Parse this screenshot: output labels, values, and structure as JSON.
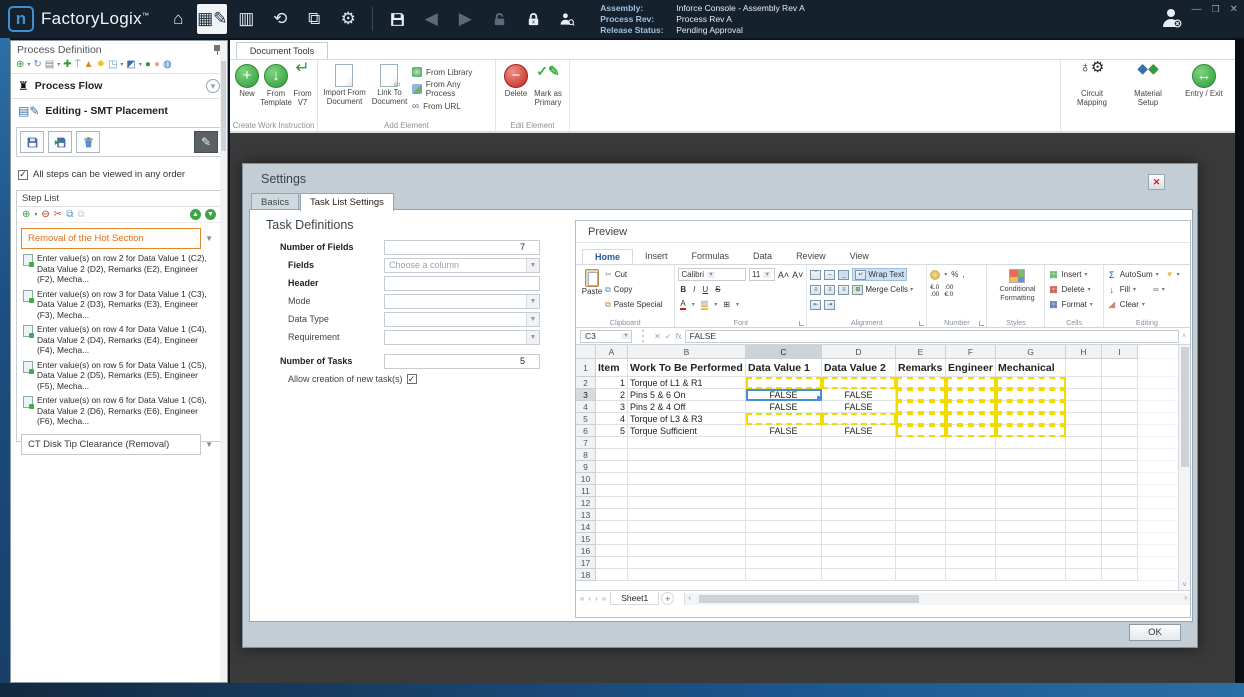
{
  "titlebar": {
    "logo_text": "FactoryLogix",
    "assembly_label": "Assembly:",
    "assembly_value": "Inforce Console - Assembly Rev A",
    "process_rev_label": "Process Rev:",
    "process_rev_value": "Process Rev A",
    "release_label": "Release Status:",
    "release_value": "Pending Approval"
  },
  "left_panel": {
    "title": "Process Definition",
    "process_flow_label": "Process Flow",
    "editing_label": "Editing - SMT Placement",
    "any_order_checkbox": "All steps can be viewed in any order",
    "step_list_title": "Step List",
    "group1": "Removal of the Hot Section",
    "steps": [
      {
        "text": "Enter value(s) on row 2 for Data Value 1 (C2), Data Value 2 (D2), Remarks (E2), Engineer (F2), Mecha..."
      },
      {
        "text": "Enter value(s) on row 3 for Data Value 1 (C3), Data Value 2 (D3), Remarks (E3), Engineer (F3), Mecha..."
      },
      {
        "text": "Enter value(s) on row 4 for Data Value 1 (C4), Data Value 2 (D4), Remarks (E4), Engineer (F4), Mecha..."
      },
      {
        "text": "Enter value(s) on row 5 for Data Value 1 (C5), Data Value 2 (D5), Remarks (E5), Engineer (F5), Mecha..."
      },
      {
        "text": "Enter value(s) on row 6 for Data Value 1 (C6), Data Value 2 (D6), Remarks (E6), Engineer (F6), Mecha..."
      }
    ],
    "group2": "CT Disk Tip Clearance (Removal)"
  },
  "ribbon": {
    "tab": "Document Tools",
    "group1_label": "Create Work Instruction",
    "new_label": "New",
    "from_template_label": "From Template",
    "from_v7_label": "From V7",
    "group2_label": "Add Element",
    "import_from_document_label": "Import From Document",
    "link_to_document_label": "Link To Document",
    "from_library_label": "From Library",
    "from_any_process_label": "From Any Process",
    "from_url_label": "From URL",
    "group3_label": "Edit Element",
    "delete_label": "Delete",
    "mark_as_primary_label": "Mark as Primary",
    "circuit_mapping_label": "Circuit Mapping",
    "material_setup_label": "Material Setup",
    "entry_exit_label": "Entry / Exit"
  },
  "dialog": {
    "title": "Settings",
    "tab_basics": "Basics",
    "tab_task_list": "Task List Settings",
    "section_title": "Task Definitions",
    "fields": {
      "number_of_fields_label": "Number of Fields",
      "number_of_fields_value": "7",
      "fields_label": "Fields",
      "fields_placeholder": "Choose a column",
      "header_label": "Header",
      "mode_label": "Mode",
      "data_type_label": "Data Type",
      "requirement_label": "Requirement",
      "number_of_tasks_label": "Number of Tasks",
      "number_of_tasks_value": "5",
      "allow_new_tasks_label": "Allow creation of new task(s)"
    },
    "ok_label": "OK"
  },
  "preview": {
    "title": "Preview",
    "excel": {
      "tabs": [
        "Home",
        "Insert",
        "Formulas",
        "Data",
        "Review",
        "View"
      ],
      "clipboard": {
        "paste": "Paste",
        "cut": "Cut",
        "copy": "Copy",
        "paste_special": "Paste Special",
        "label": "Clipboard"
      },
      "font": {
        "name": "Calibri",
        "size": "11",
        "label": "Font"
      },
      "alignment": {
        "wrap": "Wrap Text",
        "merge": "Merge Cells",
        "label": "Alignment"
      },
      "number": {
        "label": "Number"
      },
      "styles": {
        "conditional": "Conditional Formatting",
        "label": "Styles"
      },
      "cells": {
        "insert": "Insert",
        "delete": "Delete",
        "format": "Format",
        "label": "Cells"
      },
      "editing": {
        "autosum": "AutoSum",
        "fill": "Fill",
        "clear": "Clear",
        "label": "Editing"
      },
      "name_box": "C3",
      "formula_value": "FALSE",
      "sheet_tab": "Sheet1"
    }
  },
  "spreadsheet": {
    "columns": [
      "A",
      "B",
      "C",
      "D",
      "E",
      "F",
      "G",
      "H",
      "I"
    ],
    "row_count": 18,
    "selected_cell": "C3",
    "rows": [
      {
        "n": 1,
        "header": true,
        "A": "Item",
        "B": "Work To Be Performed",
        "C": "Data Value 1",
        "D": "Data Value 2",
        "E": "Remarks",
        "F": "Engineer",
        "G": "Mechanical"
      },
      {
        "n": 2,
        "A": "1",
        "B": "Torque of L1 & R1",
        "dashed": [
          "C",
          "D",
          "E",
          "F",
          "G"
        ]
      },
      {
        "n": 3,
        "A": "2",
        "B": "Pins 5 & 6 On",
        "C": "FALSE",
        "D": "FALSE",
        "dashed": [
          "E",
          "F",
          "G"
        ]
      },
      {
        "n": 4,
        "A": "3",
        "B": "Pins 2 & 4 Off",
        "C": "FALSE",
        "D": "FALSE",
        "dashed": [
          "E",
          "F",
          "G"
        ]
      },
      {
        "n": 5,
        "A": "4",
        "B": "Torque of L3 & R3",
        "dashed": [
          "C",
          "D",
          "E",
          "F",
          "G"
        ]
      },
      {
        "n": 6,
        "A": "5",
        "B": "Torque Sufficient",
        "C": "FALSE",
        "D": "FALSE",
        "dashed": [
          "E",
          "F",
          "G"
        ]
      }
    ]
  }
}
